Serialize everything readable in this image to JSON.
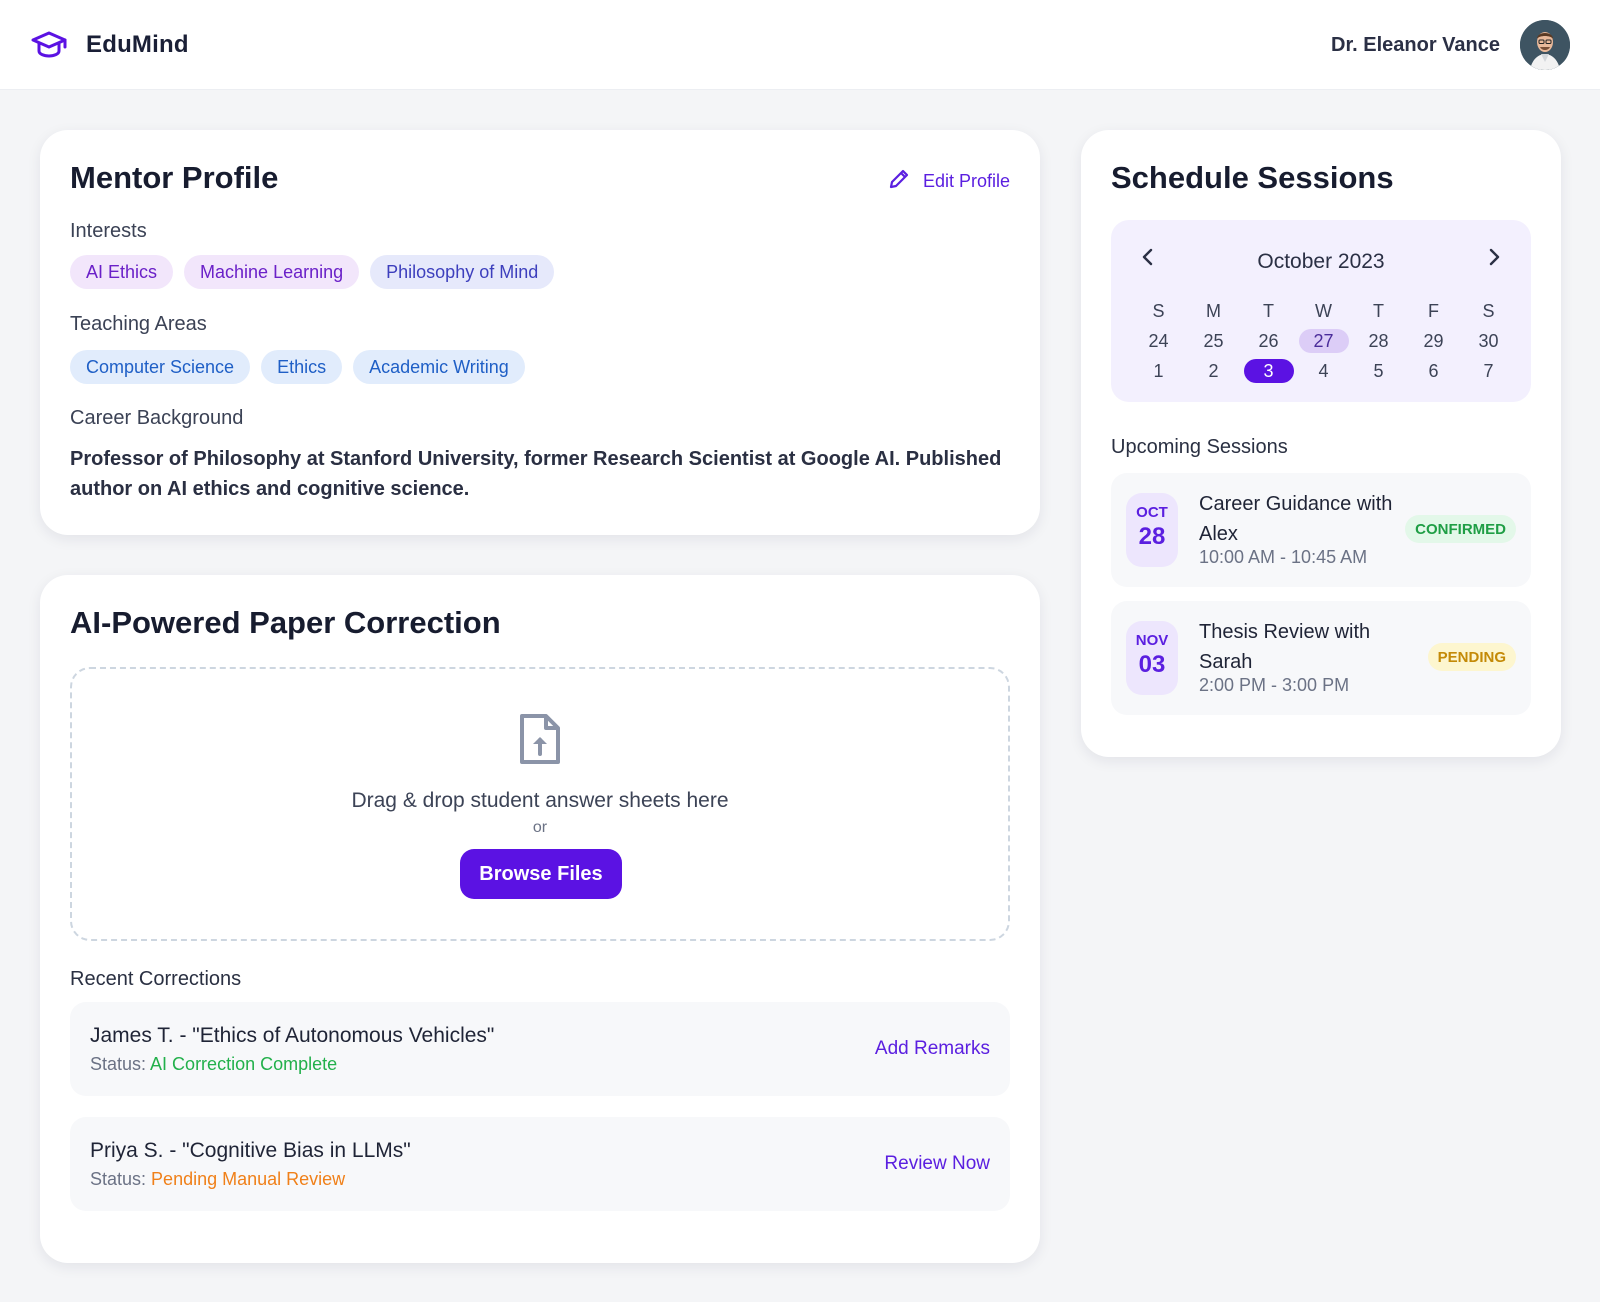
{
  "app": {
    "name": "EduMind"
  },
  "user": {
    "name": "Dr. Eleanor Vance"
  },
  "profile": {
    "title": "Mentor Profile",
    "edit_label": "Edit Profile",
    "interests_label": "Interests",
    "interests": [
      "AI Ethics",
      "Machine Learning",
      "Philosophy of Mind"
    ],
    "teaching_label": "Teaching Areas",
    "teaching": [
      "Computer Science",
      "Ethics",
      "Academic Writing"
    ],
    "career_label": "Career Background",
    "career_text": "Professor of Philosophy at Stanford University, former Research Scientist at Google AI. Published author on AI ethics and cognitive science."
  },
  "correction": {
    "title": "AI-Powered Paper Correction",
    "drop_text": "Drag & drop student answer sheets here",
    "or_text": "or",
    "browse_label": "Browse Files",
    "recent_label": "Recent Corrections",
    "items": [
      {
        "title": "James T. - \"Ethics of Autonomous Vehicles\"",
        "status_prefix": "Status:",
        "status": "AI Correction Complete",
        "action": "Add Remarks"
      },
      {
        "title": "Priya S. - \"Cognitive Bias in LLMs\"",
        "status_prefix": "Status:",
        "status": "Pending Manual Review",
        "action": "Review Now"
      }
    ]
  },
  "schedule": {
    "title": "Schedule Sessions",
    "calendar": {
      "month": "October 2023",
      "weekdays": [
        "S",
        "M",
        "T",
        "W",
        "T",
        "F",
        "S"
      ],
      "rows": [
        [
          "24",
          "25",
          "26",
          "27",
          "28",
          "29",
          "30"
        ],
        [
          "1",
          "2",
          "3",
          "4",
          "5",
          "6",
          "7"
        ]
      ],
      "highlighted_day": "27",
      "selected_day": "3"
    },
    "upcoming_label": "Upcoming Sessions",
    "sessions": [
      {
        "month": "OCT",
        "day": "28",
        "title": "Career Guidance with Alex",
        "time": "10:00 AM - 10:45 AM",
        "status": "CONFIRMED"
      },
      {
        "month": "NOV",
        "day": "03",
        "title": "Thesis Review with Sarah",
        "time": "2:00 PM - 3:00 PM",
        "status": "PENDING"
      }
    ]
  },
  "colors": {
    "accent": "#5b12e3",
    "confirmed": "#1f9e45",
    "pending": "#c48a07",
    "complete": "#22b04b",
    "manual": "#f08019"
  },
  "icons": {
    "brand": "graduation-cap-icon",
    "edit": "pencil-icon",
    "upload": "file-upload-icon",
    "prev": "chevron-left-icon",
    "next": "chevron-right-icon"
  }
}
